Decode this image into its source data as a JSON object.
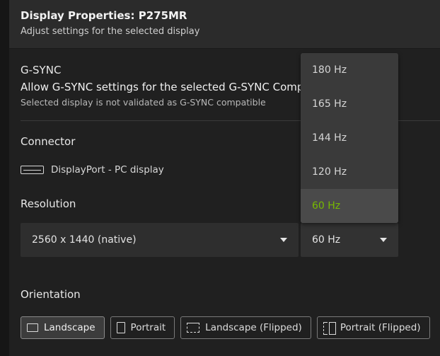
{
  "header": {
    "title": "Display Properties: P275MR",
    "subtitle": "Adjust settings for the selected display"
  },
  "gsync": {
    "title": "G-SYNC",
    "description": "Allow G-SYNC settings for the selected G-SYNC Comp",
    "note": "Selected display is not validated as G-SYNC compatible"
  },
  "connector": {
    "title": "Connector",
    "icon": "displayport-icon",
    "label": "DisplayPort - PC display"
  },
  "resolution": {
    "title": "Resolution",
    "value": "2560 x 1440 (native)",
    "refresh_value": "60 Hz"
  },
  "refresh_dropdown": {
    "options": [
      "180 Hz",
      "165 Hz",
      "144 Hz",
      "120 Hz",
      "60 Hz"
    ],
    "selected": "60 Hz"
  },
  "orientation": {
    "title": "Orientation",
    "options": [
      "Landscape",
      "Portrait",
      "Landscape (Flipped)",
      "Portrait (Flipped)"
    ],
    "selected": "Landscape"
  },
  "colors": {
    "accent": "#76b900",
    "panel": "#202020",
    "header": "#2b2b2b"
  }
}
